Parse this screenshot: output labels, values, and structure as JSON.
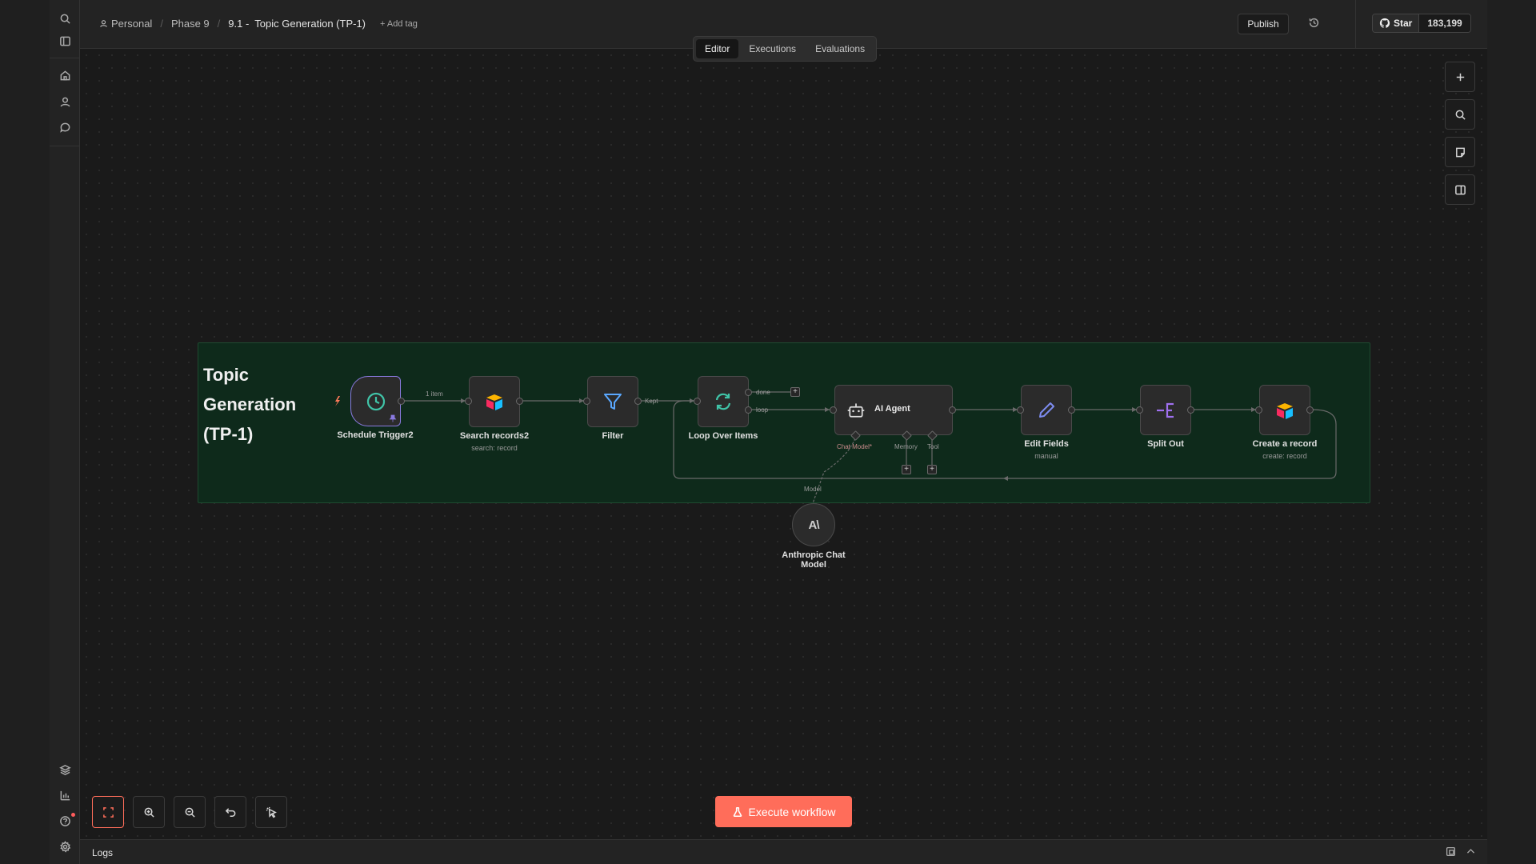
{
  "breadcrumb": {
    "project": "Personal",
    "folder": "Phase 9",
    "prefix": "9.1 -",
    "workflow": "Topic Generation (TP-1)",
    "add_tag": "+ Add tag"
  },
  "header": {
    "publish_label": "Publish",
    "github_star": "Star",
    "github_count": "183,199"
  },
  "tabs": [
    "Editor",
    "Executions",
    "Evaluations"
  ],
  "sticky_note": {
    "title_line1": "Topic",
    "title_line2": "Generation",
    "title_line3": "(TP-1)"
  },
  "nodes": {
    "schedule": {
      "label": "Schedule Trigger2",
      "icon": "clock-icon",
      "color": "#40c4a8"
    },
    "search": {
      "label": "Search records2",
      "subtitle": "search: record",
      "icon": "airtable-icon"
    },
    "filter": {
      "label": "Filter",
      "icon": "funnel-icon",
      "color": "#5aa8ff"
    },
    "loop": {
      "label": "Loop Over Items",
      "icon": "refresh-icon",
      "color": "#40c4a8"
    },
    "agent": {
      "label": "AI Agent",
      "icon": "robot-icon"
    },
    "edit": {
      "label": "Edit Fields",
      "subtitle": "manual",
      "icon": "pencil-icon",
      "color": "#7d8cf0"
    },
    "split": {
      "label": "Split Out",
      "icon": "split-icon",
      "color": "#a070f0"
    },
    "create": {
      "label": "Create a record",
      "subtitle": "create: record",
      "icon": "airtable-icon"
    },
    "anthropic": {
      "label_line1": "Anthropic Chat",
      "label_line2": "Model",
      "glyph": "A\\"
    }
  },
  "edges": {
    "item_count": "1 item",
    "kept": "Kept",
    "done": "done",
    "loop": "loop",
    "chat_model": "Chat Model*",
    "memory": "Memory",
    "tool": "Tool",
    "model": "Model"
  },
  "execute_label": "Execute workflow",
  "logs_label": "Logs",
  "colors": {
    "accent": "#ff6d5a",
    "sticky_bg": "#0e2a1b",
    "canvas_bg": "#1a1a1a"
  }
}
